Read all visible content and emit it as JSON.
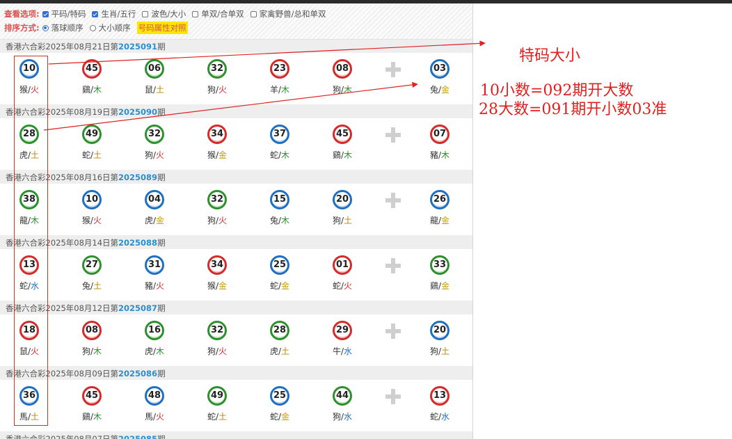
{
  "options": {
    "view_label": "查看选项:",
    "view_items": [
      {
        "label": "平码/特码",
        "checked": true
      },
      {
        "label": "生肖/五行",
        "checked": true
      },
      {
        "label": "波色/大小",
        "checked": false
      },
      {
        "label": "单双/合单双",
        "checked": false
      },
      {
        "label": "家禽野兽/总和单双",
        "checked": false
      }
    ],
    "sort_label": "排序方式:",
    "sort_items": [
      {
        "label": "落球顺序",
        "selected": true
      },
      {
        "label": "大小顺序",
        "selected": false
      }
    ],
    "compare_label": "号码属性对照"
  },
  "draws": [
    {
      "lottery": "香港六合彩",
      "date": "2025年08月21日",
      "prefix": "第",
      "period": "2025091",
      "suffix": "期",
      "balls": [
        {
          "n": "10",
          "c": "blue",
          "z": "猴",
          "e": "火"
        },
        {
          "n": "45",
          "c": "red",
          "z": "鷄",
          "e": "木"
        },
        {
          "n": "06",
          "c": "green",
          "z": "鼠",
          "e": "土"
        },
        {
          "n": "32",
          "c": "green",
          "z": "狗",
          "e": "火"
        },
        {
          "n": "23",
          "c": "red",
          "z": "羊",
          "e": "木"
        },
        {
          "n": "08",
          "c": "red",
          "z": "狗",
          "e": "木"
        }
      ],
      "special": {
        "n": "03",
        "c": "blue",
        "z": "兔",
        "e": "金"
      }
    },
    {
      "lottery": "香港六合彩",
      "date": "2025年08月19日",
      "prefix": "第",
      "period": "2025090",
      "suffix": "期",
      "balls": [
        {
          "n": "28",
          "c": "green",
          "z": "虎",
          "e": "土"
        },
        {
          "n": "49",
          "c": "green",
          "z": "蛇",
          "e": "土"
        },
        {
          "n": "32",
          "c": "green",
          "z": "狗",
          "e": "火"
        },
        {
          "n": "34",
          "c": "red",
          "z": "猴",
          "e": "金"
        },
        {
          "n": "37",
          "c": "blue",
          "z": "蛇",
          "e": "木"
        },
        {
          "n": "45",
          "c": "red",
          "z": "鷄",
          "e": "木"
        }
      ],
      "special": {
        "n": "07",
        "c": "red",
        "z": "豬",
        "e": "木"
      }
    },
    {
      "lottery": "香港六合彩",
      "date": "2025年08月16日",
      "prefix": "第",
      "period": "2025089",
      "suffix": "期",
      "balls": [
        {
          "n": "38",
          "c": "green",
          "z": "龍",
          "e": "木"
        },
        {
          "n": "10",
          "c": "blue",
          "z": "猴",
          "e": "火"
        },
        {
          "n": "04",
          "c": "blue",
          "z": "虎",
          "e": "金"
        },
        {
          "n": "32",
          "c": "green",
          "z": "狗",
          "e": "火"
        },
        {
          "n": "15",
          "c": "blue",
          "z": "兔",
          "e": "木"
        },
        {
          "n": "20",
          "c": "blue",
          "z": "狗",
          "e": "土"
        }
      ],
      "special": {
        "n": "26",
        "c": "blue",
        "z": "龍",
        "e": "金"
      }
    },
    {
      "lottery": "香港六合彩",
      "date": "2025年08月14日",
      "prefix": "第",
      "period": "2025088",
      "suffix": "期",
      "balls": [
        {
          "n": "13",
          "c": "red",
          "z": "蛇",
          "e": "水"
        },
        {
          "n": "27",
          "c": "green",
          "z": "兔",
          "e": "土"
        },
        {
          "n": "31",
          "c": "blue",
          "z": "豬",
          "e": "火"
        },
        {
          "n": "34",
          "c": "red",
          "z": "猴",
          "e": "金"
        },
        {
          "n": "25",
          "c": "blue",
          "z": "蛇",
          "e": "金"
        },
        {
          "n": "01",
          "c": "red",
          "z": "蛇",
          "e": "火"
        }
      ],
      "special": {
        "n": "33",
        "c": "green",
        "z": "鷄",
        "e": "金"
      }
    },
    {
      "lottery": "香港六合彩",
      "date": "2025年08月12日",
      "prefix": "第",
      "period": "2025087",
      "suffix": "期",
      "balls": [
        {
          "n": "18",
          "c": "red",
          "z": "鼠",
          "e": "火"
        },
        {
          "n": "08",
          "c": "red",
          "z": "狗",
          "e": "木"
        },
        {
          "n": "16",
          "c": "green",
          "z": "虎",
          "e": "木"
        },
        {
          "n": "32",
          "c": "green",
          "z": "狗",
          "e": "火"
        },
        {
          "n": "28",
          "c": "green",
          "z": "虎",
          "e": "土"
        },
        {
          "n": "29",
          "c": "red",
          "z": "牛",
          "e": "水"
        }
      ],
      "special": {
        "n": "20",
        "c": "blue",
        "z": "狗",
        "e": "土"
      }
    },
    {
      "lottery": "香港六合彩",
      "date": "2025年08月09日",
      "prefix": "第",
      "period": "2025086",
      "suffix": "期",
      "balls": [
        {
          "n": "36",
          "c": "blue",
          "z": "馬",
          "e": "土"
        },
        {
          "n": "45",
          "c": "red",
          "z": "鷄",
          "e": "木"
        },
        {
          "n": "48",
          "c": "blue",
          "z": "馬",
          "e": "火"
        },
        {
          "n": "49",
          "c": "green",
          "z": "蛇",
          "e": "土"
        },
        {
          "n": "25",
          "c": "blue",
          "z": "蛇",
          "e": "金"
        },
        {
          "n": "44",
          "c": "green",
          "z": "狗",
          "e": "水"
        }
      ],
      "special": {
        "n": "13",
        "c": "red",
        "z": "蛇",
        "e": "水"
      }
    },
    {
      "lottery": "香港六合彩",
      "date": "2025年08月07日",
      "prefix": "第",
      "period": "2025085",
      "suffix": "期",
      "balls": [],
      "special": null
    }
  ],
  "annotations": {
    "title": "特码大小",
    "line1": "10小数=092期开大数",
    "line2": "28大数=091期开小数03准",
    "color": "#e02020"
  }
}
